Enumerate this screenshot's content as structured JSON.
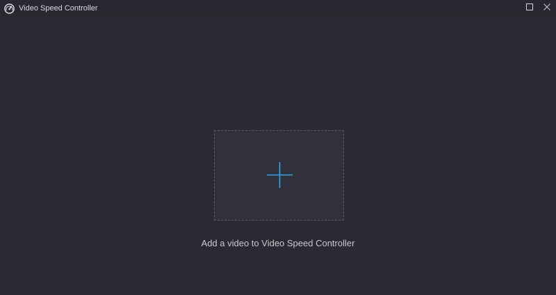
{
  "window": {
    "title": "Video Speed Controller"
  },
  "icons": {
    "app": "speedometer-icon",
    "maximize": "maximize-icon",
    "close": "close-icon",
    "add": "plus-icon"
  },
  "dropzone": {
    "caption": "Add a video to Video Speed Controller"
  },
  "colors": {
    "background": "#2a2a34",
    "dropzone_fill": "#31313c",
    "dropzone_border": "#5a5a66",
    "accent": "#2ea8f0",
    "text": "#c9c9cf"
  }
}
